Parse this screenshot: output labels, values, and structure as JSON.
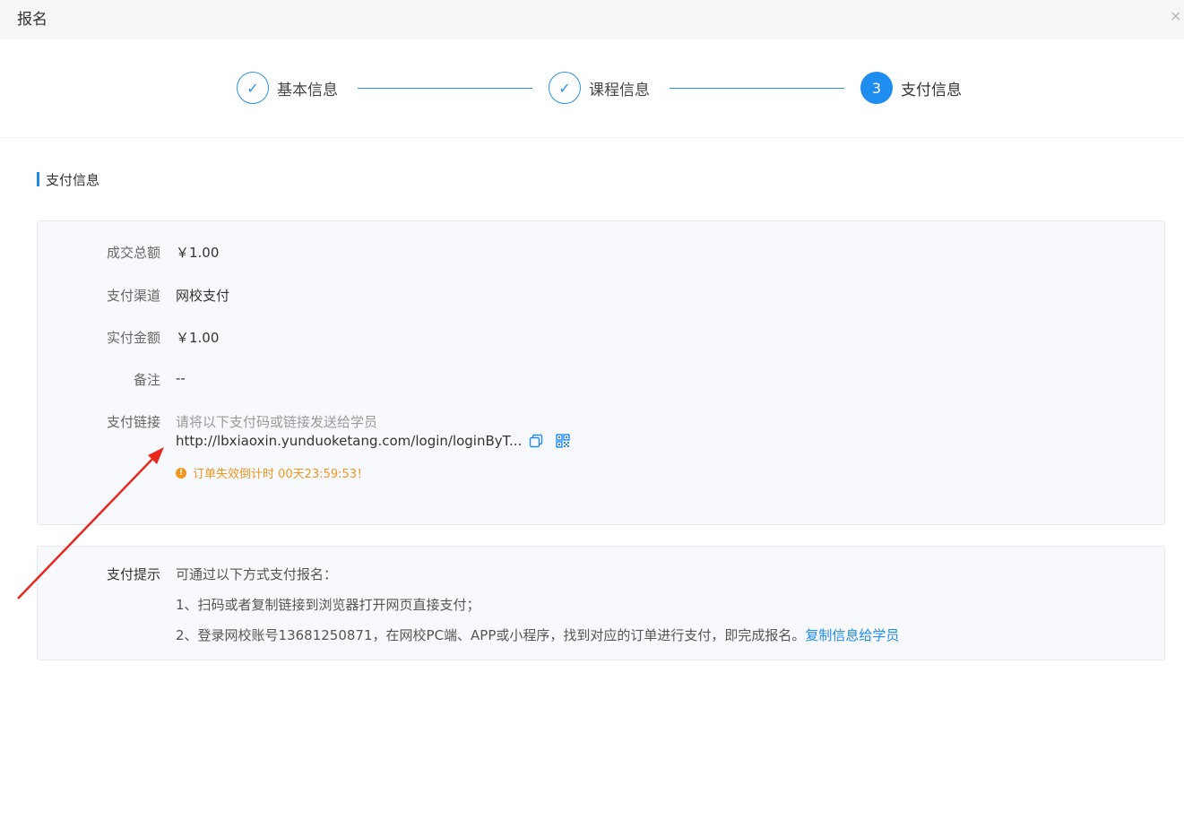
{
  "window": {
    "title": "报名",
    "close_glyph": "×"
  },
  "steps": [
    {
      "label": "基本信息",
      "state": "done",
      "glyph": "✓"
    },
    {
      "label": "课程信息",
      "state": "done",
      "glyph": "✓"
    },
    {
      "label": "支付信息",
      "state": "active",
      "glyph": "3"
    }
  ],
  "section": {
    "title": "支付信息"
  },
  "payment": {
    "total": {
      "label": "成交总额",
      "value": "￥1.00"
    },
    "channel": {
      "label": "支付渠道",
      "value": "网校支付"
    },
    "paid": {
      "label": "实付金额",
      "value": "￥1.00"
    },
    "note": {
      "label": "备注",
      "value": "--"
    },
    "link": {
      "label": "支付链接",
      "hint": "请将以下支付码或链接发送给学员",
      "url": "http://lbxiaoxin.yunduoketang.com/login/loginByT...",
      "countdown": "订单失效倒计时 00天23:59:53！",
      "copy_icon": "copy-icon",
      "qr_icon": "qrcode-icon"
    }
  },
  "tips": {
    "label": "支付提示",
    "intro": "可通过以下方式支付报名：",
    "line1": "1、扫码或者复制链接到浏览器打开网页直接支付；",
    "line2": "2、登录网校账号13681250871，在网校PC端、APP或小程序，找到对应的订单进行支付，即完成报名。",
    "copy_link": "复制信息给学员"
  },
  "colors": {
    "accent": "#1f8cf0",
    "warning": "#f0961f",
    "annotation_arrow": "#e8281e"
  }
}
